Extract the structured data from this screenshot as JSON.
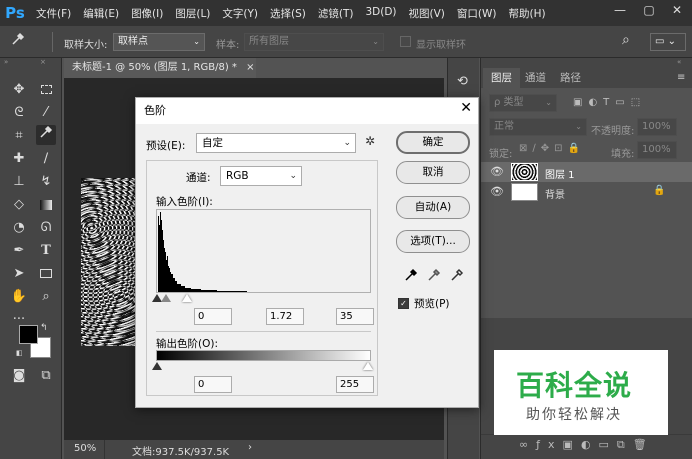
{
  "app": {
    "logo": "Ps"
  },
  "menu": [
    "文件(F)",
    "编辑(E)",
    "图像(I)",
    "图层(L)",
    "文字(Y)",
    "选择(S)",
    "滤镜(T)",
    "3D(D)",
    "视图(V)",
    "窗口(W)",
    "帮助(H)"
  ],
  "window_controls": {
    "minimize": "—",
    "restore": "▢",
    "close": "✕"
  },
  "options": {
    "sample_size_label": "取样大小:",
    "sample_size_value": "取样点",
    "sample_label": "样本:",
    "sample_value": "所有图层",
    "show_ring_label": "显示取样环"
  },
  "document": {
    "tab_title": "未标题-1 @ 50% (图层 1, RGB/8) *",
    "tab_close": "×",
    "zoom": "50%",
    "doc_info": "文档:937.5K/937.5K"
  },
  "layers_panel": {
    "tabs": [
      "图层",
      "通道",
      "路径"
    ],
    "filter_label": "ρ 类型",
    "blend_mode": "正常",
    "opacity_label": "不透明度:",
    "opacity_value": "100%",
    "lock_label": "锁定:",
    "fill_label": "填充:",
    "fill_value": "100%",
    "layers": [
      {
        "name": "图层 1",
        "selected": true
      },
      {
        "name": "背景",
        "selected": false,
        "locked": true
      }
    ]
  },
  "levels_dialog": {
    "title": "色阶",
    "close": "✕",
    "preset_label": "预设(E):",
    "preset_value": "自定",
    "channel_label": "通道:",
    "channel_value": "RGB",
    "input_label": "输入色阶(I):",
    "input_values": [
      "0",
      "1.72",
      "35"
    ],
    "output_label": "输出色阶(O):",
    "output_values": [
      "0",
      "255"
    ],
    "buttons": {
      "ok": "确定",
      "cancel": "取消",
      "auto": "自动(A)",
      "options": "选项(T)..."
    },
    "preview_label": "预览(P)",
    "preview_checked": true
  },
  "watermark": {
    "title": "百科全说",
    "subtitle": "助你轻松解决",
    "title_color": "#2dac4a"
  }
}
